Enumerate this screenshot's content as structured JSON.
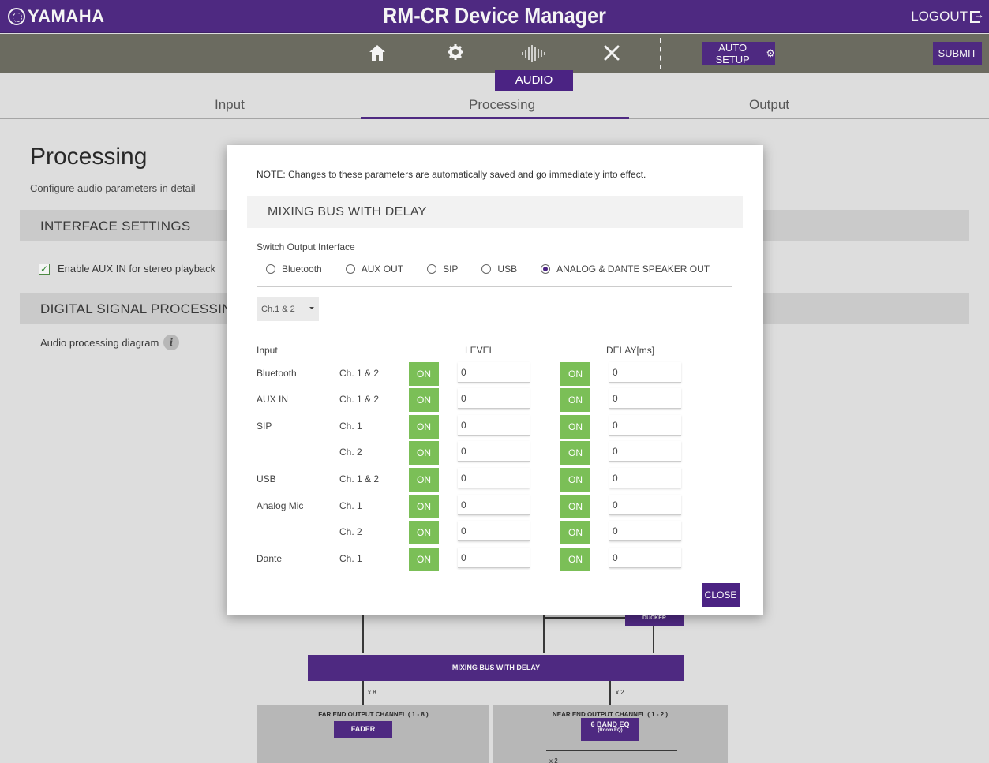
{
  "header": {
    "brand": "YAMAHA",
    "title": "RM-CR Device Manager",
    "logout_label": "LOGOUT"
  },
  "toolbar": {
    "auto_setup_label": "AUTO SETUP",
    "submit_label": "SUBMIT",
    "active_section": "AUDIO"
  },
  "tabs": [
    {
      "label": "Input"
    },
    {
      "label": "Processing"
    },
    {
      "label": "Output"
    }
  ],
  "page": {
    "title": "Processing",
    "subtitle": "Configure audio parameters in detail",
    "interface_settings_title": "INTERFACE SETTINGS",
    "aux_checkbox_label": "Enable AUX IN for stereo playback",
    "dsp_title": "DIGITAL SIGNAL PROCESSING SET",
    "diagram_label": "Audio processing diagram"
  },
  "diagram": {
    "ducker": "DUCKER",
    "mixing_bus": "MIXING BUS WITH DELAY",
    "mult_far": "x 8",
    "mult_near": "x 2",
    "far_end_title": "FAR END OUTPUT CHANNEL ( 1 - 8 )",
    "fader": "FADER",
    "near_end_title": "NEAR END OUTPUT CHANNEL ( 1 - 2 )",
    "eq_line1": "6 BAND EQ",
    "eq_line2": "(Room EQ)",
    "mult_bottom": "x 2"
  },
  "modal": {
    "note": "NOTE: Changes to these parameters are automatically saved and go immediately into effect.",
    "title": "MIXING BUS WITH DELAY",
    "switch_label": "Switch Output Interface",
    "interfaces": [
      {
        "label": "Bluetooth",
        "selected": false
      },
      {
        "label": "AUX OUT",
        "selected": false
      },
      {
        "label": "SIP",
        "selected": false
      },
      {
        "label": "USB",
        "selected": false
      },
      {
        "label": "ANALOG & DANTE SPEAKER OUT",
        "selected": true
      }
    ],
    "channel_select": "Ch.1 & 2",
    "col_input": "Input",
    "col_level": "LEVEL",
    "col_delay": "DELAY[ms]",
    "rows": [
      {
        "input": "Bluetooth",
        "channel": "Ch. 1 & 2",
        "level_on": "ON",
        "level": "0",
        "delay_on": "ON",
        "delay": "0"
      },
      {
        "input": "AUX IN",
        "channel": "Ch. 1 & 2",
        "level_on": "ON",
        "level": "0",
        "delay_on": "ON",
        "delay": "0"
      },
      {
        "input": "SIP",
        "channel": "Ch. 1",
        "level_on": "ON",
        "level": "0",
        "delay_on": "ON",
        "delay": "0"
      },
      {
        "input": "",
        "channel": "Ch. 2",
        "level_on": "ON",
        "level": "0",
        "delay_on": "ON",
        "delay": "0"
      },
      {
        "input": "USB",
        "channel": "Ch. 1 & 2",
        "level_on": "ON",
        "level": "0",
        "delay_on": "ON",
        "delay": "0"
      },
      {
        "input": "Analog Mic",
        "channel": "Ch. 1",
        "level_on": "ON",
        "level": "0",
        "delay_on": "ON",
        "delay": "0"
      },
      {
        "input": "",
        "channel": "Ch. 2",
        "level_on": "ON",
        "level": "0",
        "delay_on": "ON",
        "delay": "0"
      },
      {
        "input": "Dante",
        "channel": "Ch. 1",
        "level_on": "ON",
        "level": "0",
        "delay_on": "ON",
        "delay": "0"
      }
    ],
    "close_label": "CLOSE"
  },
  "colors": {
    "brand_purple": "#4b2383",
    "toolbar_gray": "#6b6b5f",
    "on_green": "#7bbf57"
  }
}
